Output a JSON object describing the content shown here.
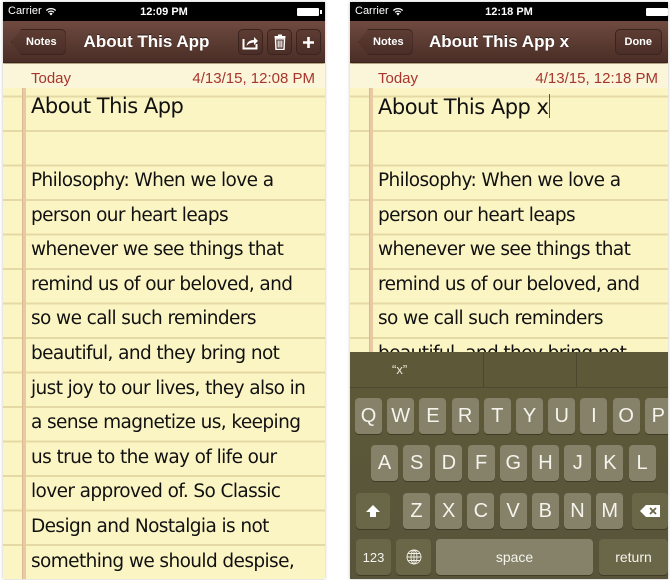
{
  "screens": [
    {
      "status": {
        "carrier": "Carrier",
        "time": "12:09 PM"
      },
      "nav": {
        "back_label": "Notes",
        "title": "About This App",
        "actions": [
          {
            "name": "share-button",
            "icon": "share-icon"
          },
          {
            "name": "trash-button",
            "icon": "trash-icon"
          },
          {
            "name": "add-note-button",
            "icon": "plus-icon"
          }
        ]
      },
      "note": {
        "day": "Today",
        "timestamp": "4/13/15, 12:08 PM",
        "title": "About This App",
        "body_lines": [
          "Philosophy: When we love a",
          "person our heart leaps",
          "whenever we see things that",
          "remind us of our beloved, and",
          "so we call such reminders",
          "beautiful, and they bring not",
          "just joy to our lives, they also in",
          "a sense magnetize us, keeping",
          "us true to the way of life our",
          "lover approved of. So Classic",
          "Design and Nostalgia is not",
          "something we should despise,"
        ]
      }
    },
    {
      "status": {
        "carrier": "Carrier",
        "time": "12:18 PM"
      },
      "nav": {
        "back_label": "Notes",
        "title": "About This App x",
        "done_label": "Done"
      },
      "note": {
        "day": "Today",
        "timestamp": "4/13/15, 12:18 PM",
        "title": "About This App x",
        "body_lines": [
          "Philosophy: When we love a",
          "person our heart leaps",
          "whenever we see things that",
          "remind us of our beloved, and",
          "so we call such reminders",
          "beautiful, and they bring not"
        ]
      },
      "keyboard": {
        "suggestions": [
          "“x”",
          "",
          ""
        ],
        "row1": [
          "Q",
          "W",
          "E",
          "R",
          "T",
          "Y",
          "U",
          "I",
          "O",
          "P"
        ],
        "row2": [
          "A",
          "S",
          "D",
          "F",
          "G",
          "H",
          "J",
          "K",
          "L"
        ],
        "row3": [
          "Z",
          "X",
          "C",
          "V",
          "B",
          "N",
          "M"
        ],
        "numbers_label": "123",
        "space_label": "space",
        "return_label": "return"
      }
    }
  ],
  "colors": {
    "nav_brown": "#5a3a31",
    "date_red": "#a6362d",
    "paper_yellow": "#fbf5c4",
    "keyboard_olive": "#5a5636",
    "key_face": "#858269"
  }
}
